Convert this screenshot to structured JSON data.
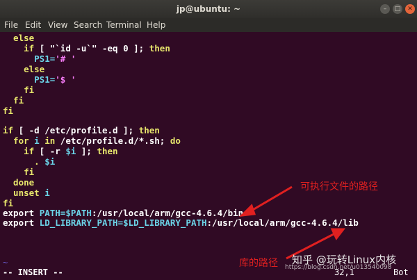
{
  "window": {
    "title": "jp@ubuntu: ~",
    "controls": {
      "minimize": "–",
      "maximize": "□",
      "close": "✕"
    }
  },
  "menu": [
    "File",
    "Edit",
    "View",
    "Search",
    "Terminal",
    "Help"
  ],
  "code": {
    "l1": "  else",
    "l2a": "    ",
    "l2b": "if",
    "l2c": " [ \"`id -u`\" -eq 0 ]; ",
    "l2d": "then",
    "l3a": "      PS1=",
    "l3b": "'# '",
    "l4": "    else",
    "l5a": "      PS1=",
    "l5b": "'$ '",
    "l6": "    fi",
    "l7": "  fi",
    "l8": "fi",
    "l9a": "if",
    "l9b": " [ -d /etc/profile.d ]; ",
    "l9c": "then",
    "l10a": "  for",
    "l10b": " i ",
    "l10c": "in",
    "l10d": " /etc/profile.d/*.sh; ",
    "l10e": "do",
    "l11a": "    if",
    "l11b": " [ -r ",
    "l11c": "$i",
    "l11d": " ]; ",
    "l11e": "then",
    "l12a": "      . ",
    "l12b": "$i",
    "l13": "    fi",
    "l14": "  done",
    "l15a": "  unset",
    "l15b": " i",
    "l16": "fi",
    "l17a": "export ",
    "l17b": "PATH=",
    "l17c": "$PATH",
    "l17d": ":/usr/local/arm/gcc-4.6.4/bin",
    "l18a": "export ",
    "l18b": "LD_LIBRARY_PATH=",
    "l18c": "$LD_LIBRARY_PATH",
    "l18d": ":/usr/local/arm/gcc-4.6.4/lib"
  },
  "tilde": "~",
  "status": {
    "mode": "-- INSERT --",
    "position": "32,1",
    "scroll": "Bot"
  },
  "annotations": {
    "exec_path": "可执行文件的路径",
    "lib_path": "库的路径"
  },
  "watermark": {
    "zhihu": "知乎 @玩转Linux内核",
    "blog": "https://blog.csdn.net/u013540098"
  },
  "colors": {
    "background": "#300a24",
    "keyword": "#e7e56c",
    "string": "#f77cf7",
    "variable": "#6bd4e8",
    "annotation": "#e02020"
  }
}
